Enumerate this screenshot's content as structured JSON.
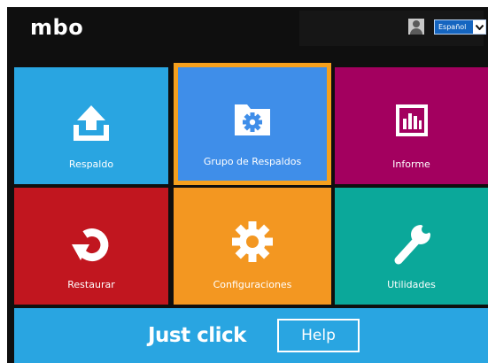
{
  "header": {
    "logo": "mbo",
    "language": "Español"
  },
  "tiles": [
    {
      "label": "Respaldo",
      "icon": "upload-icon",
      "color": "#29a5e1"
    },
    {
      "label": "Grupo de Respaldos",
      "icon": "folder-gear-icon",
      "color": "#3f8ee9",
      "selected": true,
      "highlight": "#f5a01e"
    },
    {
      "label": "Informe",
      "icon": "bar-chart-icon",
      "color": "#a3005f"
    },
    {
      "label": "Restaurar",
      "icon": "restore-icon",
      "color": "#c1161f"
    },
    {
      "label": "Configuraciones",
      "icon": "gear-icon",
      "color": "#f39721"
    },
    {
      "label": "Utilidades",
      "icon": "wrench-icon",
      "color": "#0ba89a"
    }
  ],
  "footer": {
    "tagline": "Just click",
    "help_label": "Help",
    "color": "#29a5e1"
  }
}
